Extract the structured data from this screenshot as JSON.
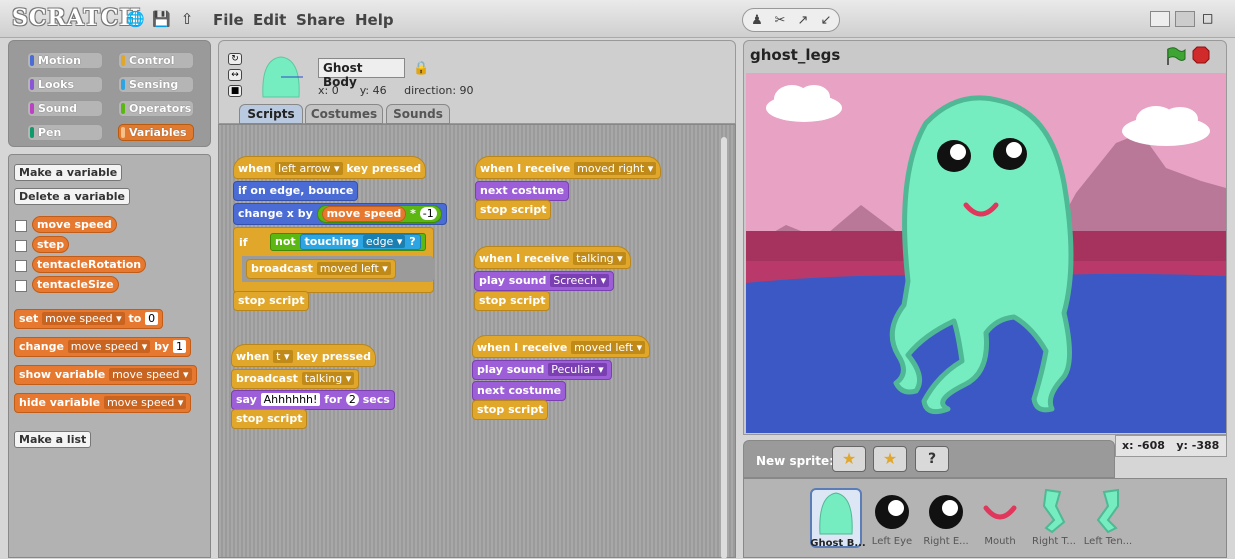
{
  "menu": {
    "file": "File",
    "edit": "Edit",
    "share": "Share",
    "help": "Help"
  },
  "logo": "SCRATCH",
  "categories": [
    {
      "label": "Motion",
      "color": "#4a6cd4"
    },
    {
      "label": "Control",
      "color": "#e1a72b"
    },
    {
      "label": "Looks",
      "color": "#8a55d7"
    },
    {
      "label": "Sensing",
      "color": "#2ca5e2"
    },
    {
      "label": "Sound",
      "color": "#bb42c3"
    },
    {
      "label": "Operators",
      "color": "#5cb712"
    },
    {
      "label": "Pen",
      "color": "#0e9a6c"
    },
    {
      "label": "Variables",
      "color": "#ee7d16"
    }
  ],
  "palette": {
    "make_variable": "Make a variable",
    "delete_variable": "Delete a variable",
    "variables": [
      "move speed",
      "step",
      "tentacleRotation",
      "tentacleSize"
    ],
    "set_label": "set",
    "set_var": "move speed",
    "set_to": "to",
    "set_value": "0",
    "change_label": "change",
    "change_var": "move speed",
    "change_by": "by",
    "change_value": "1",
    "show_label": "show variable",
    "show_var": "move speed",
    "hide_label": "hide variable",
    "hide_var": "move speed",
    "make_list": "Make a list"
  },
  "sprite": {
    "name": "Ghost Body",
    "x_label": "x:",
    "x": "0",
    "y_label": "y:",
    "y": "46",
    "dir_label": "direction:",
    "dir": "90"
  },
  "tabs": [
    "Scripts",
    "Costumes",
    "Sounds"
  ],
  "scripts": {
    "s1": {
      "when": "when",
      "key": "left arrow",
      "pressed": "key pressed",
      "edge": "if on edge, bounce",
      "changex": "change x by",
      "var": "move speed",
      "times": "*",
      "neg": "-1",
      "if": "if",
      "not": "not",
      "touching": "touching",
      "edge_obj": "edge",
      "q": "?",
      "broadcast": "broadcast",
      "msg": "moved left",
      "stop": "stop script"
    },
    "s2": {
      "when": "when",
      "key": "t",
      "pressed": "key pressed",
      "broadcast": "broadcast",
      "msg": "talking",
      "say": "say",
      "text": "Ahhhhhh!",
      "for": "for",
      "secs_val": "2",
      "secs": "secs",
      "stop": "stop script"
    },
    "s3": {
      "when": "when I receive",
      "msg": "moved right",
      "next": "next costume",
      "stop": "stop script"
    },
    "s4": {
      "when": "when I receive",
      "msg": "talking",
      "play": "play sound",
      "sound": "Screech",
      "stop": "stop script"
    },
    "s5": {
      "when": "when I receive",
      "msg": "moved left",
      "play": "play sound",
      "sound": "Peculiar",
      "next": "next costume",
      "stop": "stop script"
    }
  },
  "stage": {
    "title": "ghost_legs",
    "coords_x_label": "x:",
    "coords_x": "-608",
    "coords_y_label": "y:",
    "coords_y": "-388"
  },
  "new_sprite": "New sprite:",
  "sprites": [
    "Ghost B...",
    "Left Eye",
    "Right E...",
    "Mouth",
    "Right T...",
    "Left Ten..."
  ],
  "colors": {
    "accent": "#e07a31",
    "ghost": "#76ecc1"
  }
}
